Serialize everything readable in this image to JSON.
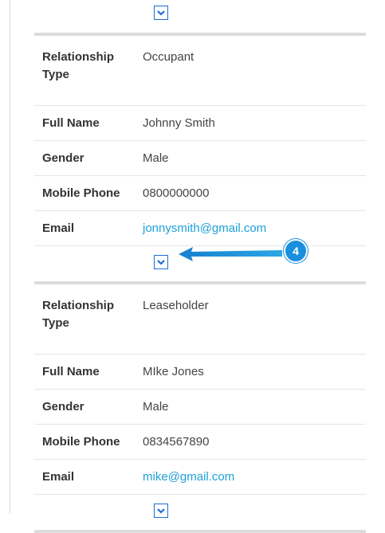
{
  "records": [
    {
      "relationship_type_label": "Relationship Type",
      "relationship_type": "Occupant",
      "full_name_label": "Full Name",
      "full_name": "Johnny Smith",
      "gender_label": "Gender",
      "gender": "Male",
      "mobile_phone_label": "Mobile Phone",
      "mobile_phone": "0800000000",
      "email_label": "Email",
      "email": "jonnysmith@gmail.com"
    },
    {
      "relationship_type_label": "Relationship Type",
      "relationship_type": "Leaseholder",
      "full_name_label": "Full Name",
      "full_name": "MIke Jones",
      "gender_label": "Gender",
      "gender": "Male",
      "mobile_phone_label": "Mobile Phone",
      "mobile_phone": "0834567890",
      "email_label": "Email",
      "email": "mike@gmail.com"
    }
  ],
  "annotation": {
    "number": "4",
    "color": "#1a8fdd"
  },
  "colors": {
    "accent": "#1a6fd8",
    "link": "#1da1d8"
  },
  "icons": {
    "toggle": "chevron-down-icon",
    "pointer": "arrow-left-icon"
  }
}
